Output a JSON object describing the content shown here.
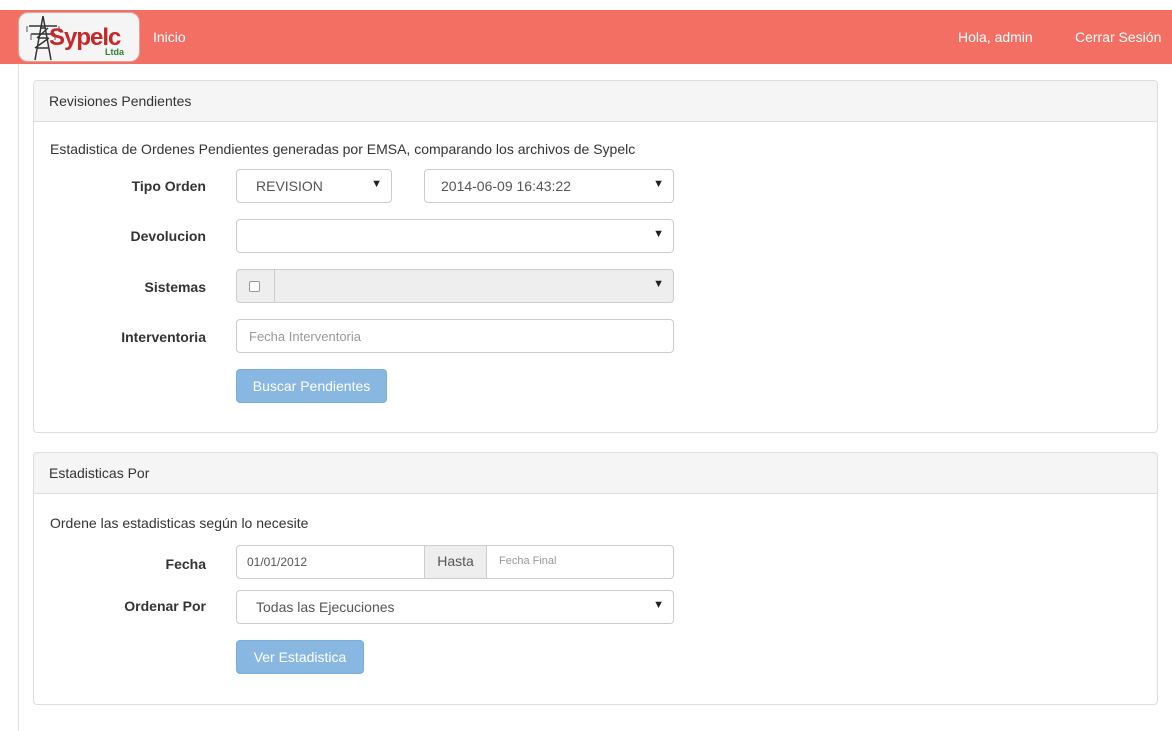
{
  "navbar": {
    "logo_text": "Sypelc",
    "logo_subtext": "Ltda",
    "home_label": "Inicio",
    "greeting": "Hola, admin",
    "logout_label": "Cerrar Sesión"
  },
  "panel1": {
    "heading": "Revisiones Pendientes",
    "description": "Estadistica de Ordenes Pendientes generadas por EMSA, comparando los archivos de Sypelc",
    "tipo_orden": {
      "label": "Tipo Orden",
      "value": "REVISION",
      "date_value": "2014-06-09 16:43:22"
    },
    "devolucion": {
      "label": "Devolucion",
      "value": ""
    },
    "sistemas": {
      "label": "Sistemas",
      "checked": false,
      "value": ""
    },
    "interventoria": {
      "label": "Interventoria",
      "placeholder": "Fecha Interventoria",
      "value": ""
    },
    "button": "Buscar Pendientes"
  },
  "panel2": {
    "heading": "Estadisticas Por",
    "description": "Ordene las estadisticas según lo necesite",
    "fecha": {
      "label": "Fecha",
      "start_value": "01/01/2012",
      "addon": "Hasta",
      "end_placeholder": "Fecha Final"
    },
    "ordenar": {
      "label": "Ordenar Por",
      "value": "Todas las Ejecuciones"
    },
    "button": "Ver Estadistica"
  },
  "colors": {
    "navbar": "#f46f63",
    "button": "#88b8e2",
    "panel_heading": "#f5f5f5"
  }
}
